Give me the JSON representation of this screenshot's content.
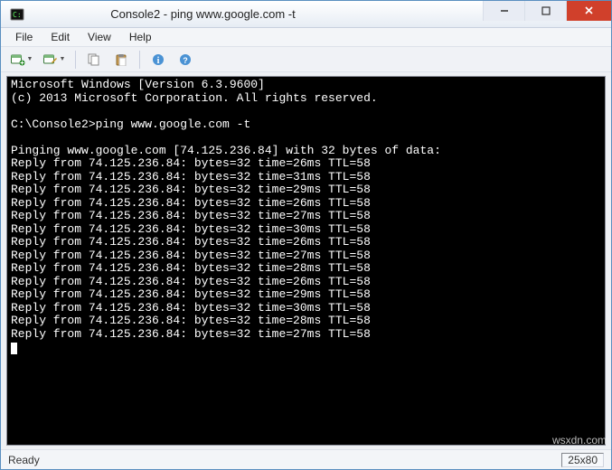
{
  "window": {
    "title": "Console2 - ping  www.google.com -t"
  },
  "menu": {
    "items": [
      "File",
      "Edit",
      "View",
      "Help"
    ]
  },
  "toolbar": {
    "icons": [
      "new-tab-icon",
      "rename-tab-icon",
      "copy-icon",
      "paste-icon",
      "info-icon",
      "help-icon"
    ]
  },
  "console": {
    "header1": "Microsoft Windows [Version 6.3.9600]",
    "header2": "(c) 2013 Microsoft Corporation. All rights reserved.",
    "prompt": "C:\\Console2>",
    "command": "ping www.google.com -t",
    "pinging": "Pinging www.google.com [74.125.236.84] with 32 bytes of data:",
    "replies": [
      {
        "ip": "74.125.236.84",
        "bytes": 32,
        "time_ms": 26,
        "ttl": 58
      },
      {
        "ip": "74.125.236.84",
        "bytes": 32,
        "time_ms": 31,
        "ttl": 58
      },
      {
        "ip": "74.125.236.84",
        "bytes": 32,
        "time_ms": 29,
        "ttl": 58
      },
      {
        "ip": "74.125.236.84",
        "bytes": 32,
        "time_ms": 26,
        "ttl": 58
      },
      {
        "ip": "74.125.236.84",
        "bytes": 32,
        "time_ms": 27,
        "ttl": 58
      },
      {
        "ip": "74.125.236.84",
        "bytes": 32,
        "time_ms": 30,
        "ttl": 58
      },
      {
        "ip": "74.125.236.84",
        "bytes": 32,
        "time_ms": 26,
        "ttl": 58
      },
      {
        "ip": "74.125.236.84",
        "bytes": 32,
        "time_ms": 27,
        "ttl": 58
      },
      {
        "ip": "74.125.236.84",
        "bytes": 32,
        "time_ms": 28,
        "ttl": 58
      },
      {
        "ip": "74.125.236.84",
        "bytes": 32,
        "time_ms": 26,
        "ttl": 58
      },
      {
        "ip": "74.125.236.84",
        "bytes": 32,
        "time_ms": 29,
        "ttl": 58
      },
      {
        "ip": "74.125.236.84",
        "bytes": 32,
        "time_ms": 30,
        "ttl": 58
      },
      {
        "ip": "74.125.236.84",
        "bytes": 32,
        "time_ms": 28,
        "ttl": 58
      },
      {
        "ip": "74.125.236.84",
        "bytes": 32,
        "time_ms": 27,
        "ttl": 58
      }
    ]
  },
  "status": {
    "left": "Ready",
    "right": "25x80"
  },
  "watermark": "wsxdn.com"
}
